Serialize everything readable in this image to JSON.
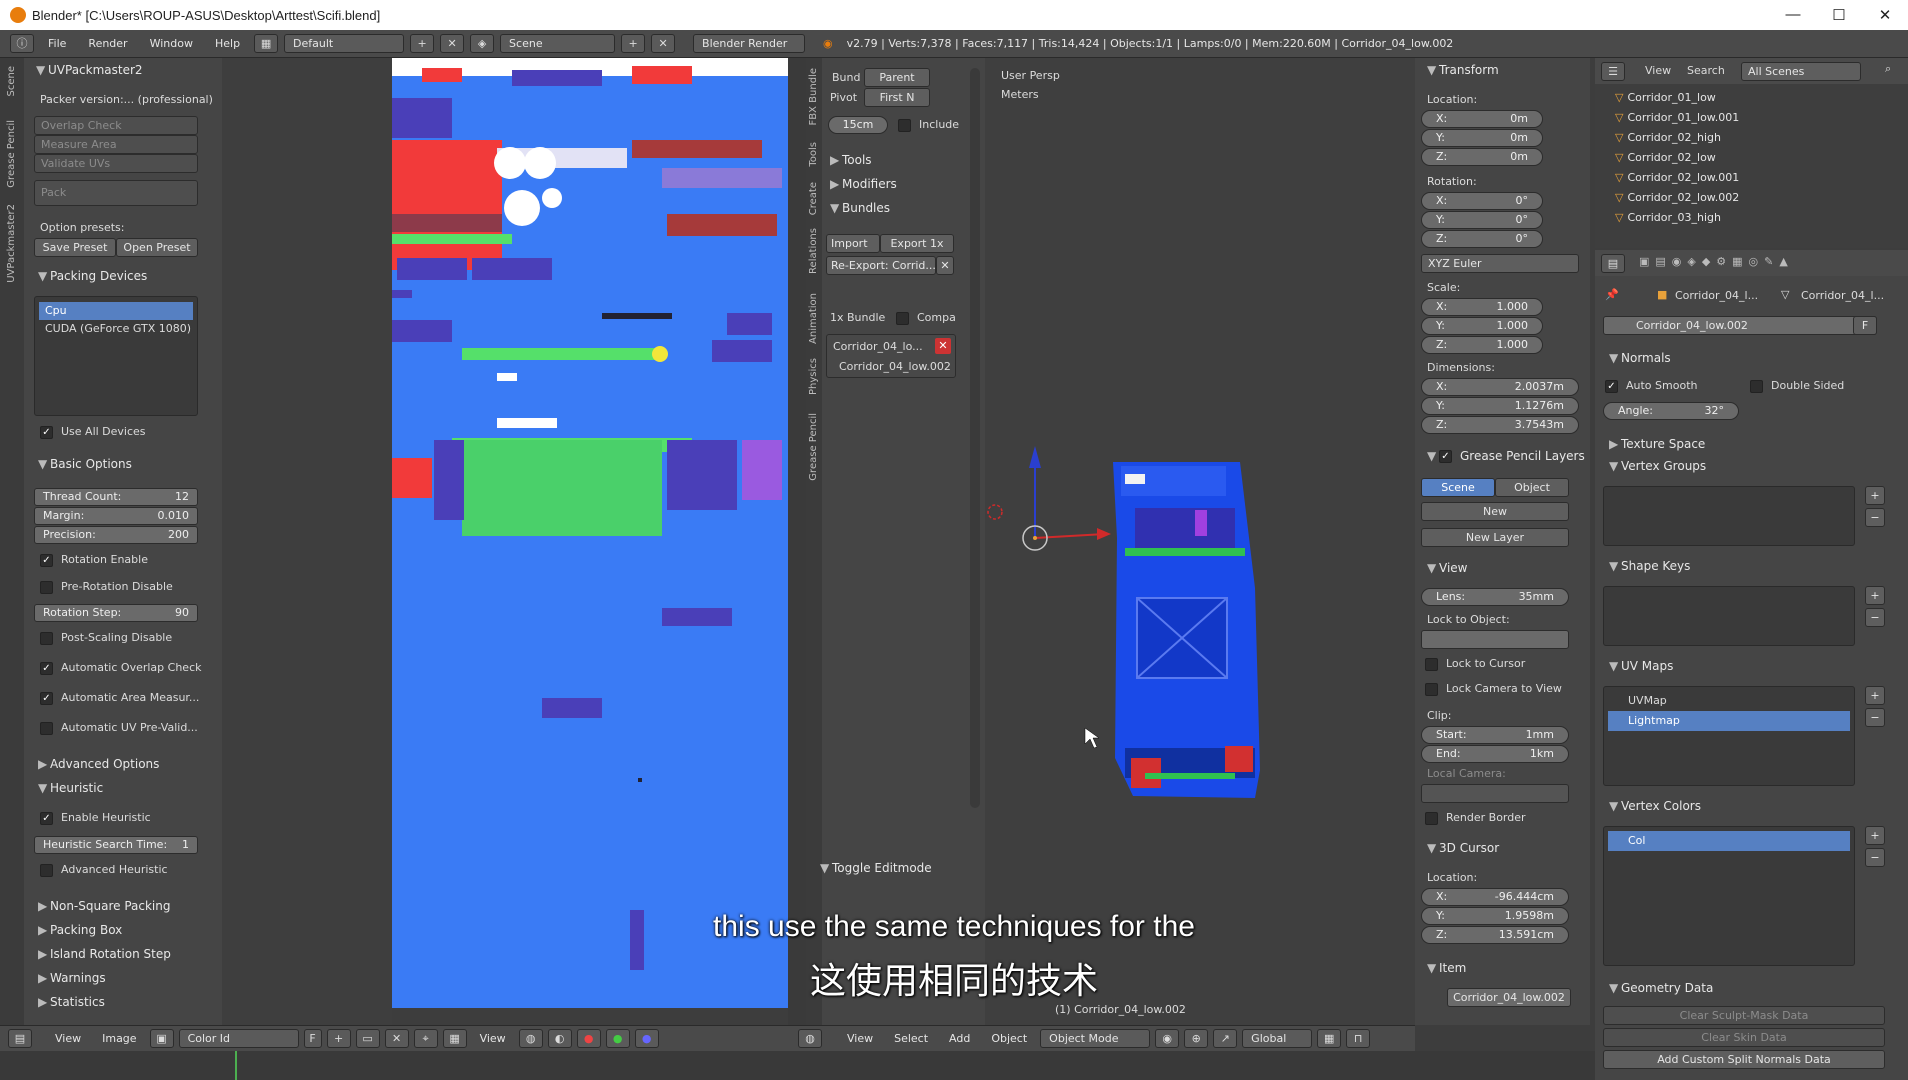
{
  "window": {
    "title": "Blender* [C:\\Users\\ROUP-ASUS\\Desktop\\Arttest\\Scifi.blend]"
  },
  "topbar": {
    "menus": [
      "File",
      "Render",
      "Window",
      "Help"
    ],
    "layout": "Default",
    "scene": "Scene",
    "engine": "Blender Render",
    "stats": "v2.79 | Verts:7,378 | Faces:7,117 | Tris:14,424 | Objects:1/1 | Lamps:0/0 | Mem:220.60M | Corridor_04_low.002"
  },
  "uvpackmaster": {
    "title": "UVPackmaster2",
    "version": "Packer version:... (professional)",
    "disabled_buttons": [
      "Overlap Check",
      "Measure Area",
      "Validate UVs",
      "Pack"
    ],
    "option_presets_label": "Option presets:",
    "save_preset": "Save Preset",
    "open_preset": "Open Preset",
    "packing_devices": "Packing Devices",
    "devices": [
      "Cpu",
      "CUDA (GeForce GTX 1080)"
    ],
    "use_all_devices": "Use All Devices",
    "basic_options": "Basic Options",
    "thread_count_label": "Thread Count:",
    "thread_count": "12",
    "margin_label": "Margin:",
    "margin": "0.010",
    "precision_label": "Precision:",
    "precision": "200",
    "rotation_enable": "Rotation Enable",
    "pre_rotation_disable": "Pre-Rotation Disable",
    "rotation_step_label": "Rotation Step:",
    "rotation_step": "90",
    "post_scaling_disable": "Post-Scaling Disable",
    "auto_overlap": "Automatic Overlap Check",
    "auto_area": "Automatic Area Measur...",
    "auto_uv": "Automatic UV Pre-Valid...",
    "advanced_options": "Advanced Options",
    "heuristic": "Heuristic",
    "enable_heuristic": "Enable Heuristic",
    "heuristic_time_label": "Heuristic Search Time:",
    "heuristic_time": "1",
    "advanced_heuristic": "Advanced Heuristic",
    "collapsed": [
      "Non-Square Packing",
      "Packing Box",
      "Island Rotation Step",
      "Warnings",
      "Statistics"
    ],
    "side_tabs": [
      "Scene",
      "Grease Pencil",
      "UVPackmaster2"
    ]
  },
  "uv_editor_bottom": {
    "view": "View",
    "image": "Image",
    "image_name": "Color Id",
    "view2": "View"
  },
  "tools_panel": {
    "bund_label": "Bund",
    "parent": "Parent",
    "pivot_label": "Pivot",
    "first_n": "First N",
    "size": "15cm",
    "include": "Include",
    "tools": "Tools",
    "modifiers": "Modifiers",
    "bundles": "Bundles",
    "import": "Import",
    "export": "Export 1x",
    "reexport": "Re-Export: Corrid...",
    "bundle_count": "1x Bundle",
    "compa": "Compa",
    "bundle_item": "Corridor_04_lo...",
    "bundle_sub": "Corridor_04_low.002",
    "toggle_editmode": "Toggle Editmode",
    "side_tabs": [
      "FBX Bundle",
      "Tools",
      "Create",
      "Relations",
      "Animation",
      "Physics",
      "Grease Pencil"
    ]
  },
  "viewport": {
    "persp": "User Persp",
    "units": "Meters",
    "object_label": "(1) Corridor_04_low.002",
    "menus": [
      "View",
      "Select",
      "Add",
      "Object"
    ],
    "mode": "Object Mode",
    "orientation": "Global"
  },
  "properties_n": {
    "transform": "Transform",
    "location_label": "Location:",
    "loc": [
      [
        "X:",
        "0m"
      ],
      [
        "Y:",
        "0m"
      ],
      [
        "Z:",
        "0m"
      ]
    ],
    "rotation_label": "Rotation:",
    "rot": [
      [
        "X:",
        "0°"
      ],
      [
        "Y:",
        "0°"
      ],
      [
        "Z:",
        "0°"
      ]
    ],
    "rot_mode": "XYZ Euler",
    "scale_label": "Scale:",
    "scale": [
      [
        "X:",
        "1.000"
      ],
      [
        "Y:",
        "1.000"
      ],
      [
        "Z:",
        "1.000"
      ]
    ],
    "dim_label": "Dimensions:",
    "dim": [
      [
        "X:",
        "2.0037m"
      ],
      [
        "Y:",
        "1.1276m"
      ],
      [
        "Z:",
        "3.7543m"
      ]
    ],
    "grease_pencil_layers": "Grease Pencil Layers",
    "scene_tab": "Scene",
    "object_tab": "Object",
    "new": "New",
    "new_layer": "New Layer",
    "view": "View",
    "lens_label": "Lens:",
    "lens": "35mm",
    "lock_to_object": "Lock to Object:",
    "lock_to_cursor": "Lock to Cursor",
    "lock_camera": "Lock Camera to View",
    "clip_label": "Clip:",
    "clip_start_label": "Start:",
    "clip_start": "1mm",
    "clip_end_label": "End:",
    "clip_end": "1km",
    "local_camera": "Local Camera:",
    "render_border": "Render Border",
    "cursor3d": "3D Cursor",
    "cursor_location": "Location:",
    "cursor": [
      [
        "X:",
        "-96.444cm"
      ],
      [
        "Y:",
        "1.9598m"
      ],
      [
        "Z:",
        "13.591cm"
      ]
    ],
    "item": "Item",
    "item_name": "Corridor_04_low.002"
  },
  "outliner": {
    "view": "View",
    "search": "Search",
    "scenes": "All Scenes",
    "items": [
      "Corridor_01_low",
      "Corridor_01_low.001",
      "Corridor_02_high",
      "Corridor_02_low",
      "Corridor_02_low.001",
      "Corridor_02_low.002",
      "Corridor_03_high"
    ]
  },
  "data_props": {
    "breadcrumb1": "Corridor_04_l...",
    "breadcrumb2": "Corridor_04_l...",
    "mesh_name": "Corridor_04_low.002",
    "fake_user": "F",
    "normals": "Normals",
    "auto_smooth": "Auto Smooth",
    "double_sided": "Double Sided",
    "angle_label": "Angle:",
    "angle": "32°",
    "texture_space": "Texture Space",
    "vertex_groups": "Vertex Groups",
    "shape_keys": "Shape Keys",
    "uv_maps": "UV Maps",
    "uvmaps": [
      "UVMap",
      "Lightmap"
    ],
    "vertex_colors": "Vertex Colors",
    "vcol": "Col",
    "geometry_data": "Geometry Data",
    "clear_sculpt": "Clear Sculpt-Mask Data",
    "clear_skin": "Clear Skin Data",
    "add_normals": "Add Custom Split Normals Data"
  },
  "subtitles": {
    "en": "this use the same techniques for the",
    "zh": "这使用相同的技术"
  },
  "colors": {
    "uv_bg": "#3a7bf5",
    "accent": "#5680c2"
  }
}
